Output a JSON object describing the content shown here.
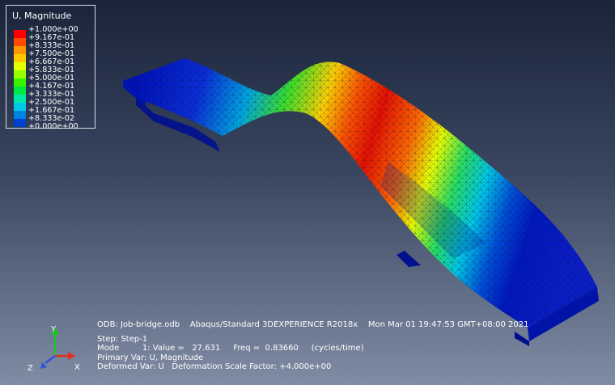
{
  "legend": {
    "title": "U, Magnitude",
    "levels": [
      {
        "label": "+1.000e+00",
        "color": "#ff0000"
      },
      {
        "label": "+9.167e-01",
        "color": "#ff4a00"
      },
      {
        "label": "+8.333e-01",
        "color": "#ff9500"
      },
      {
        "label": "+7.500e-01",
        "color": "#ffc800"
      },
      {
        "label": "+6.667e-01",
        "color": "#e3ff00"
      },
      {
        "label": "+5.833e-01",
        "color": "#95ff00"
      },
      {
        "label": "+5.000e-01",
        "color": "#3cf000"
      },
      {
        "label": "+4.167e-01",
        "color": "#00e840"
      },
      {
        "label": "+3.333e-01",
        "color": "#00e8a8"
      },
      {
        "label": "+2.500e-01",
        "color": "#00c8e8"
      },
      {
        "label": "+1.667e-01",
        "color": "#0082e0"
      },
      {
        "label": "+8.333e-02",
        "color": "#0040d0"
      },
      {
        "label": "+0.000e+00",
        "color": "#0000c0"
      }
    ]
  },
  "info": {
    "odb_line": "ODB: Job-bridge.odb    Abaqus/Standard 3DEXPERIENCE R2018x    Mon Mar 01 19:47:53 GMT+08:00 2021",
    "step_line": "Step: Step-1",
    "mode_line": "Mode         1: Value =   27.631     Freq =  0.83660     (cycles/time)",
    "primary_line": "Primary Var: U, Magnitude",
    "deformed_line": "Deformed Var: U   Deformation Scale Factor: +4.000e+00"
  },
  "triad": {
    "x_label": "X",
    "y_label": "Y",
    "z_label": "Z",
    "x_color": "#e03020",
    "y_color": "#20c030",
    "z_color": "#3050e0"
  }
}
